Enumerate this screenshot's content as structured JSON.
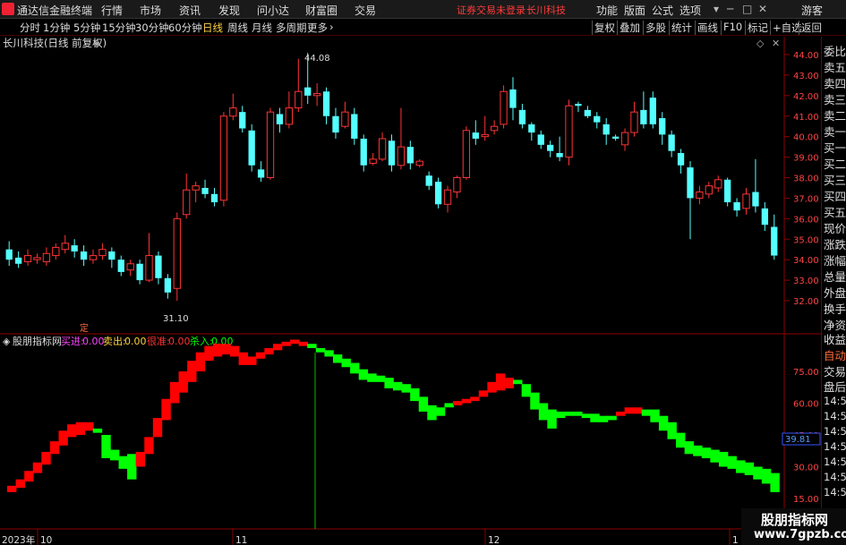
{
  "app": {
    "title": "通达信金融终端"
  },
  "menu": [
    "行情",
    "市场",
    "资讯",
    "发现",
    "问小达",
    "财富圈",
    "交易"
  ],
  "warning": "证券交易未登录",
  "stock_name": "长川科技",
  "right_menu": [
    "功能",
    "版面",
    "公式",
    "选项"
  ],
  "guest": "游客",
  "periods": [
    "分时",
    "1分钟",
    "5分钟",
    "15分钟",
    "30分钟",
    "60分钟",
    "日线",
    "周线",
    "月线",
    "多周期",
    "更多"
  ],
  "active_period": "日线",
  "tools": [
    "复权",
    "叠加",
    "多股",
    "统计",
    "画线",
    "F10",
    "标记",
    "+自选",
    "返回"
  ],
  "main_header": "长川科技(日线 前复权)",
  "ind_header": {
    "name": "股朋指标网",
    "buy_label": "买进:",
    "buy_val": "0.00",
    "sell_label": "卖出:",
    "sell_val": "0.00",
    "hold_label": "很准:",
    "hold_val": "0.00",
    "kill_label": "杀入:",
    "kill_val": "0.00"
  },
  "price_axis": [
    "44.00",
    "43.00",
    "42.00",
    "41.00",
    "40.00",
    "39.00",
    "38.00",
    "37.00",
    "36.00",
    "35.00",
    "34.00",
    "33.00",
    "32.00"
  ],
  "ind_axis": [
    "75.00",
    "60.00",
    "45.00",
    "30.00",
    "15.00"
  ],
  "ind_current": "39.81",
  "high_label": "44.08",
  "low_label": "31.10",
  "ding_label": "定",
  "x_labels": [
    "2023年",
    "10",
    "11",
    "12",
    "1"
  ],
  "side_panel": [
    "委比",
    "卖五",
    "卖四",
    "卖三",
    "卖二",
    "卖一",
    "买一",
    "买二",
    "买三",
    "买四",
    "买五",
    "现价",
    "涨跌",
    "涨幅",
    "总量",
    "外盘",
    "换手",
    "净资",
    "收益"
  ],
  "side_auto": "自动",
  "side_trade": "交易",
  "side_after": "盘后",
  "side_times": [
    "14:56",
    "14:56",
    "14:56",
    "14:56",
    "14:56",
    "14:56",
    "14:56"
  ],
  "watermark": {
    "cn": "股朋指标网",
    "url": "www.7gpzb.com"
  },
  "colors": {
    "up": "#ff3333",
    "down": "#54ffff",
    "ind_up": "#ff0000",
    "ind_down": "#00ff00",
    "axis": "#8b0000"
  },
  "chart_data": {
    "type": "candlestick",
    "ylim": [
      31.5,
      44.5
    ],
    "candles": [
      [
        34.5,
        34.0,
        34.9,
        33.7
      ],
      [
        34.1,
        33.8,
        34.4,
        33.6
      ],
      [
        33.9,
        34.2,
        34.5,
        33.7
      ],
      [
        34.0,
        34.1,
        34.3,
        33.8
      ],
      [
        33.9,
        34.3,
        34.6,
        33.7
      ],
      [
        34.2,
        34.6,
        34.8,
        34.0
      ],
      [
        34.5,
        34.8,
        35.2,
        34.3
      ],
      [
        34.7,
        34.4,
        35.0,
        34.1
      ],
      [
        34.4,
        34.0,
        34.7,
        33.7
      ],
      [
        34.0,
        34.2,
        34.5,
        33.8
      ],
      [
        34.2,
        34.5,
        34.8,
        34.0
      ],
      [
        34.4,
        34.0,
        34.6,
        33.6
      ],
      [
        34.0,
        33.4,
        34.2,
        33.2
      ],
      [
        33.5,
        33.8,
        34.0,
        33.2
      ],
      [
        33.8,
        33.0,
        34.0,
        32.8
      ],
      [
        33.0,
        34.2,
        35.3,
        32.9
      ],
      [
        34.2,
        33.1,
        34.4,
        32.8
      ],
      [
        33.1,
        32.4,
        33.3,
        32.1
      ],
      [
        32.6,
        36.0,
        36.3,
        32.0
      ],
      [
        36.2,
        37.4,
        38.2,
        36.0
      ],
      [
        37.4,
        37.6,
        37.8,
        36.8
      ],
      [
        37.5,
        37.2,
        37.9,
        37.0
      ],
      [
        37.2,
        36.8,
        37.5,
        36.6
      ],
      [
        36.9,
        41.0,
        41.2,
        36.6
      ],
      [
        41.0,
        41.4,
        42.1,
        40.8
      ],
      [
        41.2,
        40.4,
        41.5,
        40.2
      ],
      [
        40.3,
        38.6,
        40.6,
        38.3
      ],
      [
        38.4,
        38.0,
        38.8,
        37.8
      ],
      [
        38.0,
        41.2,
        41.4,
        37.9
      ],
      [
        41.1,
        40.6,
        41.4,
        40.2
      ],
      [
        40.6,
        41.4,
        42.2,
        40.4
      ],
      [
        41.4,
        42.2,
        43.8,
        41.2
      ],
      [
        42.4,
        42.0,
        44.08,
        41.6
      ],
      [
        42.0,
        42.1,
        42.6,
        41.5
      ],
      [
        42.2,
        41.0,
        42.4,
        40.6
      ],
      [
        41.0,
        40.2,
        41.4,
        39.9
      ],
      [
        40.5,
        41.2,
        41.7,
        40.4
      ],
      [
        41.1,
        39.9,
        41.4,
        39.6
      ],
      [
        39.9,
        38.6,
        40.1,
        38.3
      ],
      [
        38.7,
        38.9,
        39.2,
        38.6
      ],
      [
        38.9,
        39.9,
        40.2,
        38.8
      ],
      [
        39.8,
        38.6,
        40.1,
        38.3
      ],
      [
        38.6,
        39.5,
        41.4,
        38.4
      ],
      [
        39.5,
        38.7,
        39.8,
        38.4
      ],
      [
        38.6,
        38.8,
        38.9,
        38.5
      ],
      [
        38.1,
        37.6,
        38.3,
        37.4
      ],
      [
        37.8,
        36.7,
        38.0,
        36.5
      ],
      [
        36.7,
        37.4,
        37.6,
        36.3
      ],
      [
        37.3,
        38.0,
        38.1,
        37.0
      ],
      [
        38.0,
        40.3,
        40.5,
        37.9
      ],
      [
        40.2,
        39.9,
        40.8,
        39.6
      ],
      [
        40.0,
        40.1,
        41.0,
        39.8
      ],
      [
        40.3,
        40.5,
        40.8,
        40.1
      ],
      [
        40.6,
        42.2,
        42.5,
        40.4
      ],
      [
        42.3,
        41.4,
        42.9,
        40.8
      ],
      [
        41.3,
        40.6,
        41.6,
        40.4
      ],
      [
        40.6,
        40.2,
        40.7,
        39.8
      ],
      [
        40.1,
        39.6,
        40.3,
        39.4
      ],
      [
        39.6,
        39.3,
        39.8,
        39.0
      ],
      [
        39.2,
        39.0,
        40.0,
        38.8
      ],
      [
        39.0,
        41.5,
        41.8,
        38.6
      ],
      [
        41.6,
        41.5,
        41.7,
        41.2
      ],
      [
        41.3,
        41.0,
        41.5,
        40.9
      ],
      [
        41.0,
        40.7,
        41.2,
        40.4
      ],
      [
        40.6,
        40.1,
        40.9,
        39.6
      ],
      [
        40.0,
        39.9,
        40.1,
        39.8
      ],
      [
        39.6,
        40.2,
        40.4,
        39.3
      ],
      [
        40.2,
        41.2,
        41.7,
        40.0
      ],
      [
        41.3,
        40.6,
        42.2,
        40.4
      ],
      [
        41.9,
        40.6,
        42.2,
        40.4
      ],
      [
        40.9,
        40.1,
        41.2,
        39.6
      ],
      [
        40.1,
        39.3,
        40.3,
        39.0
      ],
      [
        39.2,
        38.6,
        39.4,
        38.2
      ],
      [
        38.5,
        37.0,
        38.8,
        35.0
      ],
      [
        37.0,
        37.3,
        37.6,
        36.7
      ],
      [
        37.2,
        37.6,
        37.8,
        37.0
      ],
      [
        37.5,
        37.9,
        38.1,
        37.3
      ],
      [
        37.9,
        36.8,
        38.0,
        36.6
      ],
      [
        36.8,
        36.4,
        37.0,
        36.1
      ],
      [
        36.5,
        37.2,
        37.5,
        36.2
      ],
      [
        37.3,
        36.6,
        38.9,
        36.3
      ],
      [
        36.5,
        35.7,
        36.8,
        35.4
      ],
      [
        35.6,
        34.2,
        36.2,
        34.0
      ]
    ],
    "indicator": {
      "ylim": [
        15,
        90
      ],
      "blocks": [
        [
          18,
          21,
          "r"
        ],
        [
          20,
          24,
          "r"
        ],
        [
          23,
          28,
          "r"
        ],
        [
          27,
          32,
          "r"
        ],
        [
          31,
          37,
          "r"
        ],
        [
          36,
          42,
          "r"
        ],
        [
          40,
          47,
          "r"
        ],
        [
          44,
          50,
          "r"
        ],
        [
          45,
          51,
          "r"
        ],
        [
          47,
          51,
          "r"
        ],
        [
          46,
          48,
          "g"
        ],
        [
          34,
          45,
          "g"
        ],
        [
          33,
          38,
          "g"
        ],
        [
          29,
          35,
          "g"
        ],
        [
          24,
          36,
          "g"
        ],
        [
          30,
          37,
          "r"
        ],
        [
          36,
          44,
          "r"
        ],
        [
          44,
          53,
          "r"
        ],
        [
          52,
          62,
          "r"
        ],
        [
          60,
          70,
          "r"
        ],
        [
          65,
          75,
          "r"
        ],
        [
          70,
          80,
          "r"
        ],
        [
          75,
          84,
          "r"
        ],
        [
          80,
          87,
          "r"
        ],
        [
          82,
          88,
          "r"
        ],
        [
          83,
          88,
          "r"
        ],
        [
          82,
          87,
          "r"
        ],
        [
          78,
          84,
          "r"
        ],
        [
          78,
          82,
          "r"
        ],
        [
          81,
          84,
          "r"
        ],
        [
          83,
          86,
          "r"
        ],
        [
          85,
          88,
          "r"
        ],
        [
          87,
          89,
          "r"
        ],
        [
          88,
          90,
          "r"
        ],
        [
          87,
          89,
          "r"
        ],
        [
          86,
          88,
          "g"
        ],
        [
          84,
          86,
          "g"
        ],
        [
          82,
          85,
          "g"
        ],
        [
          79,
          83,
          "g"
        ],
        [
          77,
          81,
          "g"
        ],
        [
          74,
          79,
          "g"
        ],
        [
          71,
          76,
          "g"
        ],
        [
          70,
          74,
          "g"
        ],
        [
          70,
          73,
          "g"
        ],
        [
          67,
          72,
          "g"
        ],
        [
          66,
          70,
          "g"
        ],
        [
          65,
          69,
          "g"
        ],
        [
          61,
          67,
          "g"
        ],
        [
          56,
          63,
          "g"
        ],
        [
          52,
          59,
          "g"
        ],
        [
          54,
          58,
          "g"
        ],
        [
          58,
          60,
          "g"
        ],
        [
          59,
          61,
          "r"
        ],
        [
          60,
          62,
          "r"
        ],
        [
          61,
          63,
          "r"
        ],
        [
          63,
          66,
          "r"
        ],
        [
          65,
          70,
          "r"
        ],
        [
          66,
          74,
          "r"
        ],
        [
          67,
          72,
          "r"
        ],
        [
          69,
          71,
          "g"
        ],
        [
          63,
          69,
          "g"
        ],
        [
          57,
          65,
          "g"
        ],
        [
          52,
          60,
          "g"
        ],
        [
          48,
          57,
          "g"
        ],
        [
          53,
          56,
          "g"
        ],
        [
          54,
          56,
          "g"
        ],
        [
          54,
          56,
          "g"
        ],
        [
          53,
          55,
          "g"
        ],
        [
          51,
          55,
          "g"
        ],
        [
          51,
          54,
          "g"
        ],
        [
          52,
          54,
          "g"
        ],
        [
          54,
          56,
          "r"
        ],
        [
          55,
          58,
          "r"
        ],
        [
          55,
          58,
          "r"
        ],
        [
          54,
          57,
          "g"
        ],
        [
          51,
          57,
          "g"
        ],
        [
          47,
          54,
          "g"
        ],
        [
          43,
          51,
          "g"
        ],
        [
          39,
          46,
          "g"
        ],
        [
          36,
          42,
          "g"
        ],
        [
          35,
          40,
          "g"
        ],
        [
          34,
          39,
          "g"
        ],
        [
          32,
          38,
          "g"
        ],
        [
          30,
          37,
          "g"
        ],
        [
          29,
          35,
          "g"
        ],
        [
          27,
          33,
          "g"
        ],
        [
          26,
          32,
          "g"
        ],
        [
          24,
          30,
          "g"
        ],
        [
          22,
          29,
          "g"
        ],
        [
          18,
          27,
          "g"
        ]
      ]
    }
  }
}
